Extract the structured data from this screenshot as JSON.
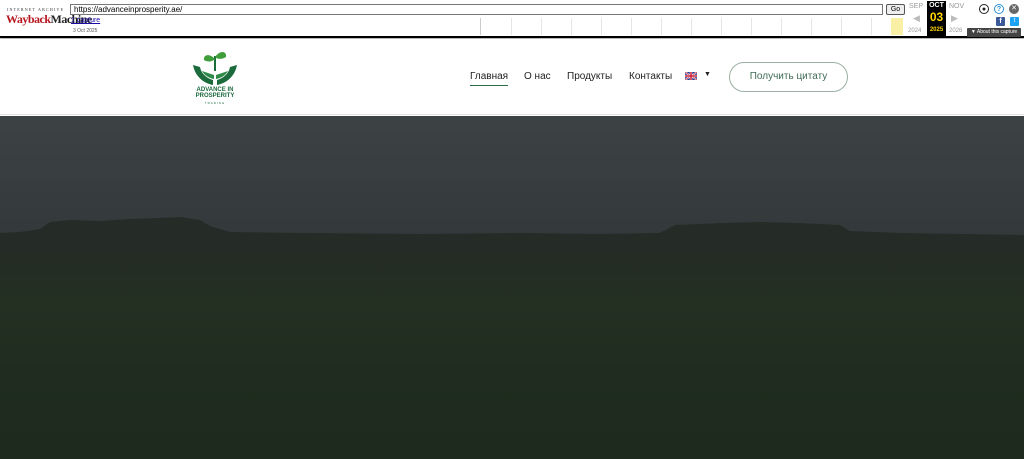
{
  "wayback": {
    "brand_small": "INTERNET ARCHIVE",
    "brand_way": "Wayback",
    "brand_machine": "Machine",
    "url": "https://advanceinprosperity.ae/",
    "go_label": "Go",
    "captures_link": "1 capture",
    "captures_date": "3 Oct 2025",
    "prev_month": "SEP",
    "current_month": "OCT",
    "next_month": "NOV",
    "current_day": "03",
    "prev_year": "2024",
    "current_year": "2025",
    "next_year": "2026",
    "about_label": "About this capture"
  },
  "site": {
    "logo_line1": "ADVANCE IN",
    "logo_line2": "PROSPERITY",
    "logo_line3": "TRADING",
    "nav": [
      {
        "label": "Главная",
        "active": true
      },
      {
        "label": "О нас"
      },
      {
        "label": "Продукты"
      },
      {
        "label": "Контакты"
      }
    ],
    "language": "en-gb-flag",
    "quote_button": "Получить цитату"
  },
  "colors": {
    "brand_green": "#1b6b3d",
    "accent_yellow": "#ffd400",
    "wayback_red": "#b6161e"
  }
}
